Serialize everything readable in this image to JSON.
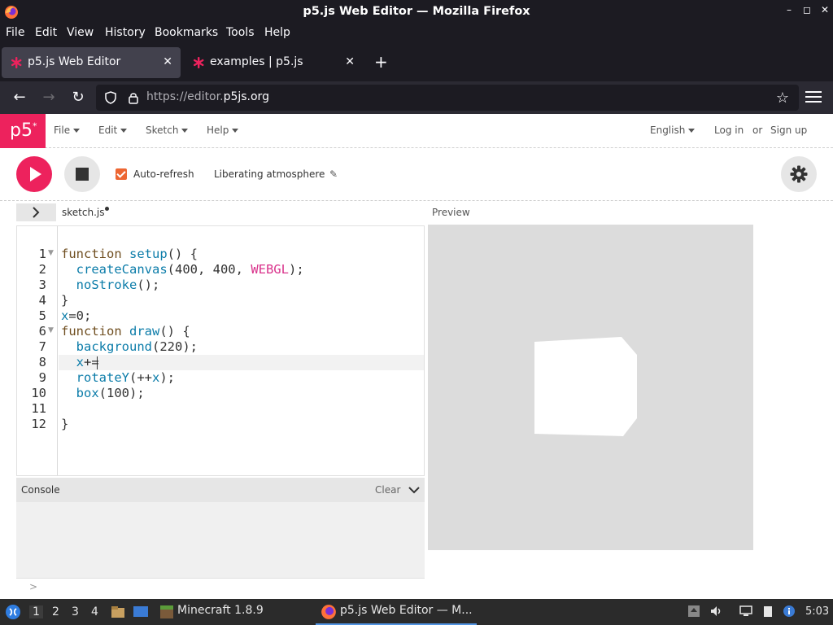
{
  "window": {
    "title": "p5.js Web Editor — Mozilla Firefox",
    "controls": [
      "–",
      "◻",
      "✕"
    ]
  },
  "menubar": [
    "File",
    "Edit",
    "View",
    "History",
    "Bookmarks",
    "Tools",
    "Help"
  ],
  "tabs": [
    {
      "label": "p5.js Web Editor",
      "active": true
    },
    {
      "label": "examples | p5.js",
      "active": false
    }
  ],
  "nav": {
    "url_dim": "https://editor.",
    "url_main": "p5js.org"
  },
  "p5menu": {
    "logo": "p5",
    "logo_sup": "*",
    "items": [
      "File",
      "Edit",
      "Sketch",
      "Help"
    ],
    "language": "English",
    "login": "Log in",
    "or": "or",
    "signup": "Sign up"
  },
  "toolbar": {
    "autorefresh_label": "Auto-refresh",
    "autorefresh_checked": true,
    "sketch_name": "Liberating atmosphere",
    "accent": "#ed225d"
  },
  "editor": {
    "file_name": "sketch.js",
    "unsaved": true,
    "preview_label": "Preview",
    "active_line": 8,
    "lines": [
      "function setup() {",
      "  createCanvas(400, 400, WEBGL);",
      "  noStroke();",
      "}",
      "x=0;",
      "function draw() {",
      "  background(220);",
      "  x+=",
      "  rotateY(++x);",
      "  box(100);",
      "",
      "}"
    ],
    "line_numbers": [
      "1",
      "2",
      "3",
      "4",
      "5",
      "6",
      "7",
      "8",
      "9",
      "10",
      "11",
      "12"
    ]
  },
  "console": {
    "title": "Console",
    "clear_label": "Clear",
    "prompt": ">"
  },
  "preview": {
    "background_color": "#dcdcdc",
    "shape_color": "#ffffff"
  },
  "taskbar": {
    "workspaces": [
      "1",
      "2",
      "3",
      "4"
    ],
    "active_workspace": "1",
    "apps": [
      {
        "label": "Minecraft 1.8.9"
      },
      {
        "label": "p5.js Web Editor — M..."
      }
    ],
    "clock": "5:03"
  }
}
